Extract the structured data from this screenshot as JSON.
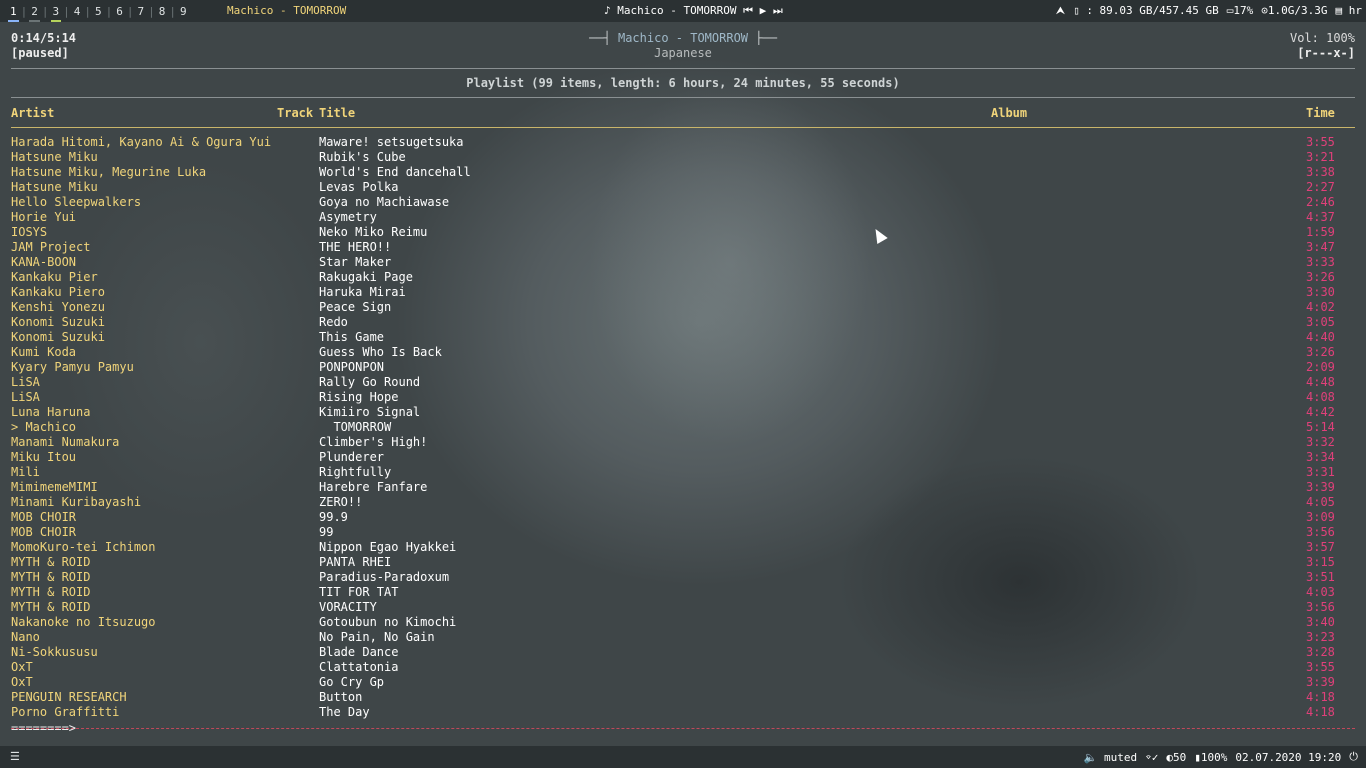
{
  "topbar": {
    "workspaces": [
      "1",
      "2",
      "3",
      "4",
      "5",
      "6",
      "7",
      "8",
      "9"
    ],
    "window_title": "Machico - TOMORROW",
    "now_playing": "♪ Machico - TOMORROW",
    "media_controls": "⏮ ▶ ⏭",
    "disk": ": 89.03 GB/457.45 GB",
    "cpu": "17%",
    "mem": "1.0G/3.3G",
    "kbd": "hr"
  },
  "player": {
    "elapsed": "0:14/5:14",
    "state": "[paused]",
    "song": "Machico - TOMORROW",
    "genre": "Japanese",
    "volume": "Vol: 100%",
    "modes": "[r---x-]",
    "playlist_info": "Playlist (99 items, length: 6 hours, 24 minutes, 55 seconds)",
    "progress": "========>"
  },
  "columns": {
    "artist": "Artist",
    "track": "Track",
    "title": "Title",
    "album": "Album",
    "time": "Time"
  },
  "rows": [
    {
      "artist": "Harada Hitomi, Kayano Ai & Ogura Yui",
      "title": "Maware! setsugetsuka",
      "time": "3:55"
    },
    {
      "artist": "Hatsune Miku",
      "title": "Rubik's Cube",
      "time": "3:21"
    },
    {
      "artist": "Hatsune Miku, Megurine Luka",
      "title": "World's End dancehall",
      "time": "3:38"
    },
    {
      "artist": "Hatsune Miku",
      "title": "Levas Polka",
      "time": "2:27"
    },
    {
      "artist": "Hello Sleepwalkers",
      "title": "Goya no Machiawase",
      "time": "2:46"
    },
    {
      "artist": "Horie Yui",
      "title": "Asymetry",
      "time": "4:37"
    },
    {
      "artist": "IOSYS",
      "title": "Neko Miko Reimu",
      "time": "1:59"
    },
    {
      "artist": "JAM Project",
      "title": "THE HERO!!",
      "time": "3:47"
    },
    {
      "artist": "KANA-BOON",
      "title": "Star Maker",
      "time": "3:33"
    },
    {
      "artist": "Kankaku Pier",
      "title": "Rakugaki Page",
      "time": "3:26"
    },
    {
      "artist": "Kankaku Piero",
      "title": "Haruka Mirai",
      "time": "3:30"
    },
    {
      "artist": "Kenshi Yonezu",
      "title": "Peace Sign",
      "time": "4:02"
    },
    {
      "artist": "Konomi Suzuki",
      "title": "Redo",
      "time": "3:05"
    },
    {
      "artist": "Konomi Suzuki",
      "title": "This Game",
      "time": "4:40"
    },
    {
      "artist": "Kumi Koda",
      "title": "Guess Who Is Back",
      "time": "3:26"
    },
    {
      "artist": "Kyary Pamyu Pamyu",
      "title": "PONPONPON",
      "time": "2:09"
    },
    {
      "artist": "LiSA",
      "title": "Rally Go Round",
      "time": "4:48"
    },
    {
      "artist": "LiSA",
      "title": "Rising Hope",
      "time": "4:08"
    },
    {
      "artist": "Luna Haruna",
      "title": "Kimiiro Signal",
      "time": "4:42"
    },
    {
      "artist": "> Machico",
      "title": "  TOMORROW",
      "time": "5:14"
    },
    {
      "artist": "Manami Numakura",
      "title": "Climber's High!",
      "time": "3:32"
    },
    {
      "artist": "Miku Itou",
      "title": "Plunderer",
      "time": "3:34"
    },
    {
      "artist": "Mili",
      "title": "Rightfully",
      "time": "3:31"
    },
    {
      "artist": "MimimemeMIMI",
      "title": "Harebre Fanfare",
      "time": "3:39"
    },
    {
      "artist": "Minami Kuribayashi",
      "title": "ZERO!!",
      "time": "4:05"
    },
    {
      "artist": "MOB CHOIR",
      "title": "99.9",
      "time": "3:09"
    },
    {
      "artist": "MOB CHOIR",
      "title": "99",
      "time": "3:56"
    },
    {
      "artist": "MomoKuro-tei Ichimon",
      "title": "Nippon Egao Hyakkei",
      "time": "3:57"
    },
    {
      "artist": "MYTH & ROID",
      "title": "PANTA RHEI",
      "time": "3:15"
    },
    {
      "artist": "MYTH & ROID",
      "title": "Paradius-Paradoxum",
      "time": "3:51"
    },
    {
      "artist": "MYTH & ROID",
      "title": "TIT FOR TAT",
      "time": "4:03"
    },
    {
      "artist": "MYTH & ROID",
      "title": "VORACITY",
      "time": "3:56"
    },
    {
      "artist": "Nakanoke no Itsuzugo",
      "title": "Gotoubun no Kimochi",
      "time": "3:40"
    },
    {
      "artist": "Nano",
      "title": "No Pain, No Gain",
      "time": "3:23"
    },
    {
      "artist": "Ni-Sokkususu",
      "title": "Blade Dance",
      "time": "3:28"
    },
    {
      "artist": "OxT",
      "title": "Clattatonia",
      "time": "3:55"
    },
    {
      "artist": "OxT",
      "title": "Go Cry Gp",
      "time": "3:39"
    },
    {
      "artist": "PENGUIN RESEARCH",
      "title": "Button",
      "time": "4:18"
    },
    {
      "artist": "Porno Graffitti",
      "title": "The Day",
      "time": "4:18"
    }
  ],
  "bottombar": {
    "menu": "☰",
    "volume": "🔈 muted",
    "wifi": "✓",
    "brightness": "50",
    "battery": "100%",
    "datetime": "02.07.2020 19:20",
    "power": "⏻"
  }
}
